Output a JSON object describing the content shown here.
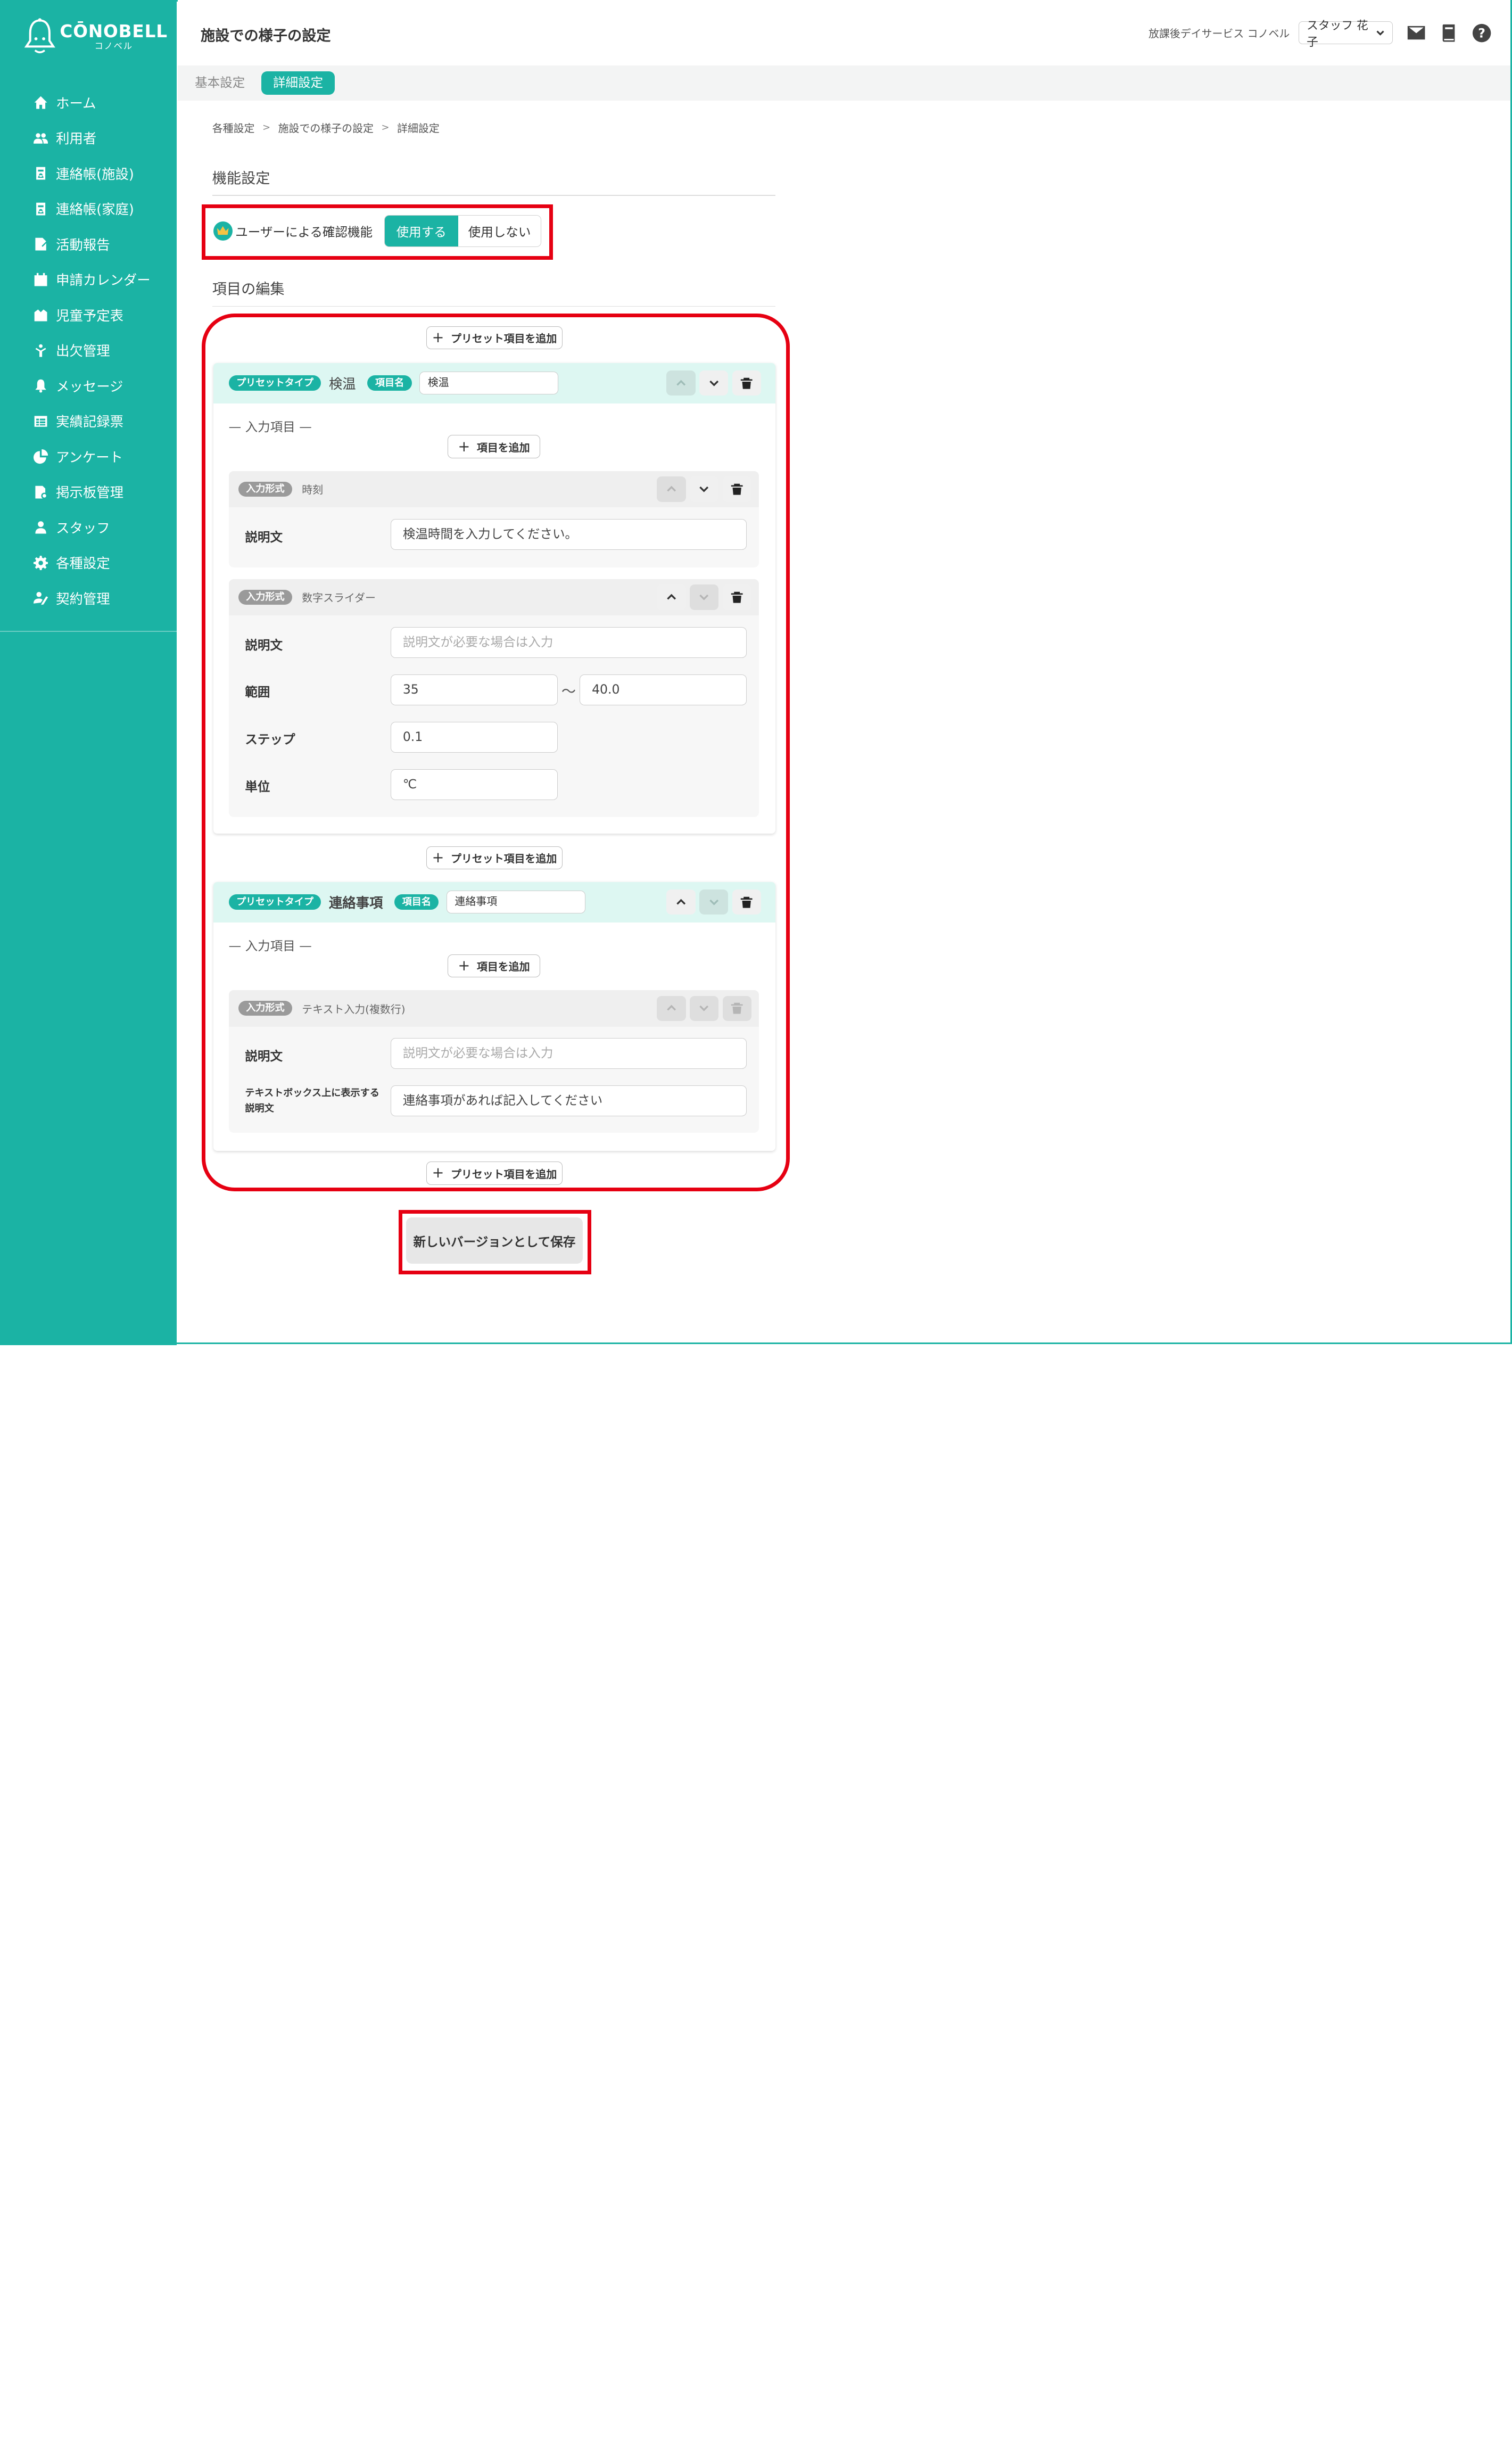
{
  "app": {
    "logo_main": "CŌNOBELL",
    "logo_sub": "コノベル",
    "brand_color": "#1bb3a4",
    "highlight_color": "#e60012"
  },
  "sidebar": {
    "items": [
      {
        "label": "ホーム",
        "icon": "home-icon"
      },
      {
        "label": "利用者",
        "icon": "users-icon"
      },
      {
        "label": "連絡帳(施設)",
        "icon": "contact-book-icon"
      },
      {
        "label": "連絡帳(家庭)",
        "icon": "contact-book-icon"
      },
      {
        "label": "活動報告",
        "icon": "report-icon"
      },
      {
        "label": "申請カレンダー",
        "icon": "calendar-icon"
      },
      {
        "label": "児童予定表",
        "icon": "schedule-icon"
      },
      {
        "label": "出欠管理",
        "icon": "attendance-icon"
      },
      {
        "label": "メッセージ",
        "icon": "bell-icon"
      },
      {
        "label": "実績記録票",
        "icon": "table-icon"
      },
      {
        "label": "アンケート",
        "icon": "pie-chart-icon"
      },
      {
        "label": "掲示板管理",
        "icon": "board-icon"
      },
      {
        "label": "スタッフ",
        "icon": "staff-icon"
      },
      {
        "label": "各種設定",
        "icon": "gear-icon"
      },
      {
        "label": "契約管理",
        "icon": "contract-icon"
      }
    ]
  },
  "header": {
    "title": "施設での様子の設定",
    "facility": "放課後デイサービス コノベル",
    "user": "スタッフ 花子",
    "icons": [
      "mail-icon",
      "book-icon",
      "help-icon"
    ]
  },
  "tabs": {
    "basic": "基本設定",
    "detail": "詳細設定"
  },
  "breadcrumb": [
    "各種設定",
    "施設での様子の設定",
    "詳細設定"
  ],
  "function_settings": {
    "title": "機能設定",
    "confirm_label": "ユーザーによる確認機能",
    "use": "使用する",
    "not_use": "使用しない",
    "selected": "使用する"
  },
  "edit_items": {
    "title": "項目の編集",
    "add_preset": "プリセット項目を追加",
    "add_item": "項目を追加",
    "preset_type_badge": "プリセットタイプ",
    "item_name_badge": "項目名",
    "input_items_title": "— 入力項目 —",
    "input_format_badge": "入力形式",
    "presets": [
      {
        "type": "検温",
        "name": "検温",
        "inputs": [
          {
            "format": "時刻",
            "description_label": "説明文",
            "description_value": "検温時間を入力してください。"
          },
          {
            "format": "数字スライダー",
            "description_label": "説明文",
            "description_placeholder": "説明文が必要な場合は入力",
            "range_label": "範囲",
            "range_min": "35",
            "range_sep": "〜",
            "range_max": "40.0",
            "step_label": "ステップ",
            "step": "0.1",
            "unit_label": "単位",
            "unit": "℃"
          }
        ]
      },
      {
        "type": "連絡事項",
        "name": "連絡事項",
        "inputs": [
          {
            "format": "テキスト入力(複数行)",
            "description_label": "説明文",
            "description_placeholder": "説明文が必要な場合は入力",
            "textbox_label_line1": "テキストボックス上に表示する",
            "textbox_label_line2": "説明文",
            "textbox_value": "連絡事項があれば記入してください"
          }
        ]
      }
    ]
  },
  "save_button": "新しいバージョンとして保存"
}
